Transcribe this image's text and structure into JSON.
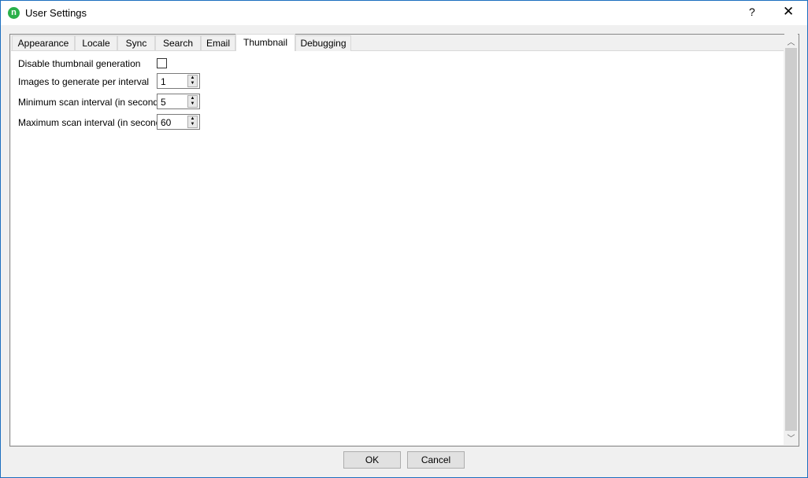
{
  "window": {
    "title": "User Settings",
    "help": "?",
    "close": "✕",
    "accent": "#1c6fbf",
    "icon_color": "#2ab04a"
  },
  "tabs": [
    {
      "label": "Appearance"
    },
    {
      "label": "Locale"
    },
    {
      "label": "Sync"
    },
    {
      "label": "Search"
    },
    {
      "label": "Email"
    },
    {
      "label": "Thumbnail",
      "selected": true
    },
    {
      "label": "Debugging"
    }
  ],
  "thumbnail": {
    "disable_label": "Disable thumbnail generation",
    "disable_checked": false,
    "images_label": "Images to generate per interval",
    "images_value": "1",
    "min_label": "Minimum scan interval (in seconds)",
    "min_value": "5",
    "max_label": "Maximum scan interval (in seconds)",
    "max_value": "60"
  },
  "buttons": {
    "ok": "OK",
    "cancel": "Cancel"
  }
}
